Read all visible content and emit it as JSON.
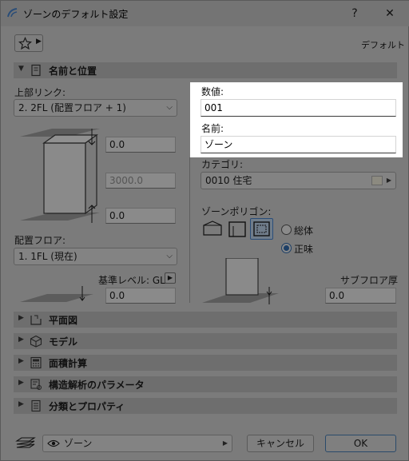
{
  "window": {
    "title": "ゾーンのデフォルト設定",
    "help_label": "?",
    "close_label": "✕"
  },
  "toolbar": {
    "favorites_icon": "star-icon",
    "default_label": "デフォルト"
  },
  "section_name_position": {
    "title": "名前と位置"
  },
  "top_link": {
    "label": "上部リンク:",
    "value": "2. 2FL (配置フロア + 1)"
  },
  "geometry": {
    "top_offset": "0.0",
    "height": "3000.0",
    "bottom_offset": "0.0"
  },
  "home_story": {
    "label": "配置フロア:",
    "value": "1. 1FL (現在)"
  },
  "reference_level": {
    "label": "基準レベル: GL",
    "value": "0.0"
  },
  "zone_number": {
    "label": "数値:",
    "value": "001"
  },
  "zone_name": {
    "label": "名前:",
    "value": "ゾーン"
  },
  "category": {
    "label": "カテゴリ:",
    "value": "0010  住宅"
  },
  "zone_polygon": {
    "label": "ゾーンポリゴン:",
    "options": [
      "総体",
      "正味"
    ],
    "selected": "正味"
  },
  "subfloor": {
    "label": "サブフロア厚さ:",
    "value": "0.0"
  },
  "sections": [
    {
      "title": "平面図"
    },
    {
      "title": "モデル"
    },
    {
      "title": "面積計算"
    },
    {
      "title": "構造解析のパラメータ"
    },
    {
      "title": "分類とプロパティ"
    }
  ],
  "footer": {
    "layer_value": "ゾーン",
    "cancel_label": "キャンセル",
    "ok_label": "OK"
  }
}
